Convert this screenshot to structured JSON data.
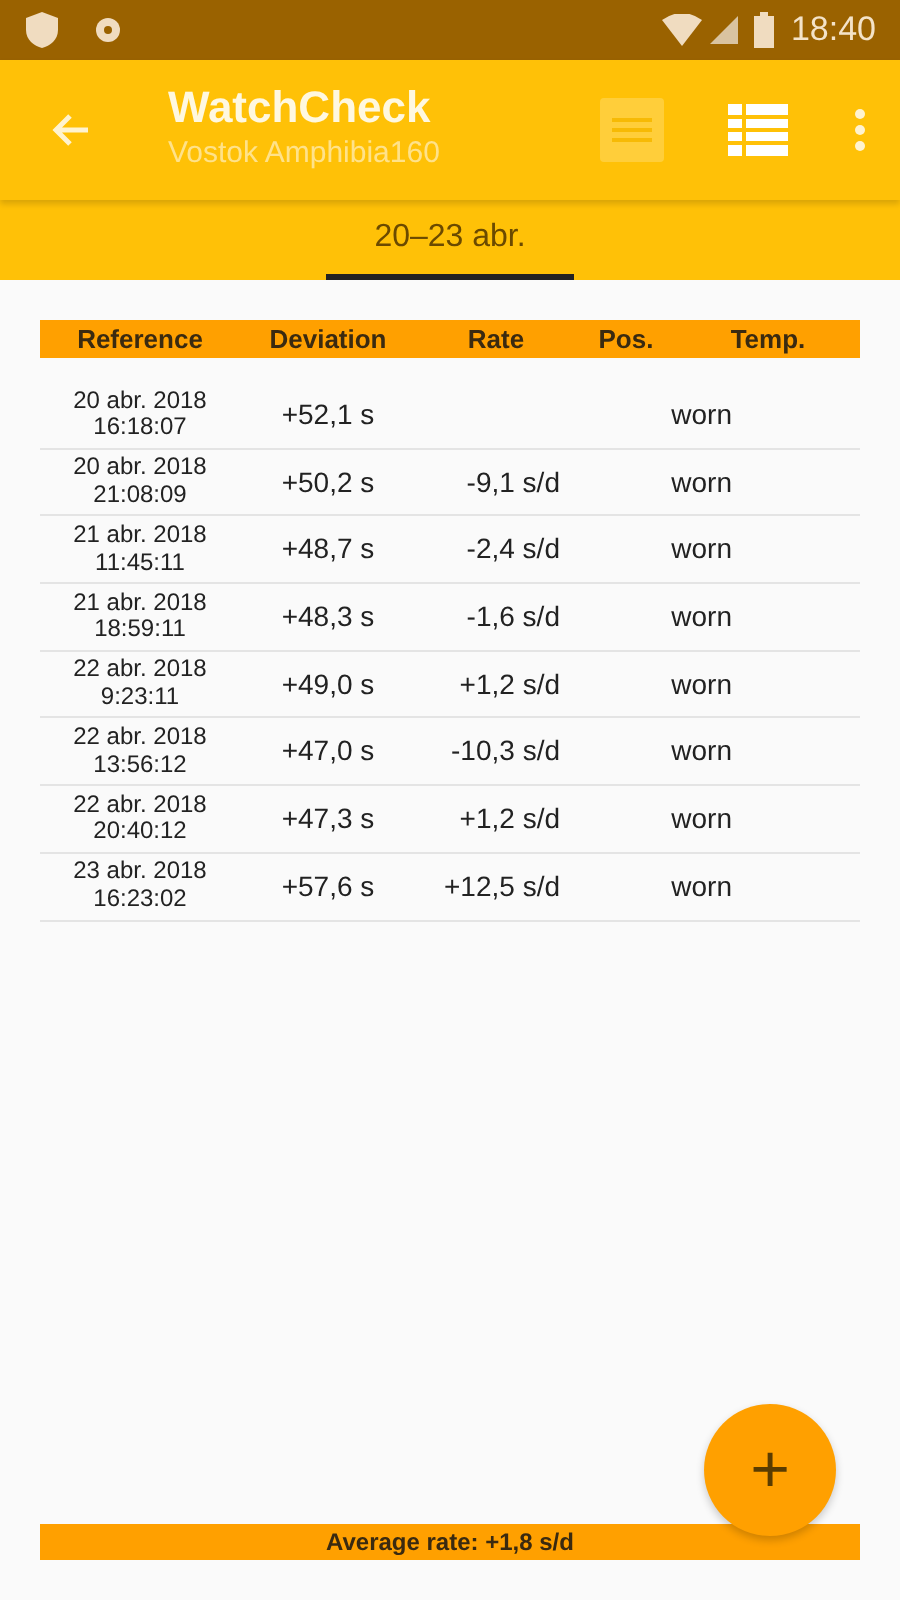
{
  "status_bar": {
    "time": "18:40"
  },
  "app_bar": {
    "title": "WatchCheck",
    "subtitle": "Vostok Amphibia160",
    "actions": [
      {
        "kind": "list",
        "disabled": true
      },
      {
        "kind": "table",
        "disabled": false
      },
      {
        "kind": "more",
        "disabled": false
      }
    ]
  },
  "tabs": [
    {
      "label": "20–23 abr.",
      "selected": true
    }
  ],
  "table": {
    "columns": [
      "Reference",
      "Deviation",
      "Rate",
      "Pos.",
      "Temp."
    ],
    "rows": [
      {
        "date": "20 abr. 2018",
        "time": "16:18:07",
        "deviation": "+52,1 s",
        "position": "worn"
      },
      {
        "date": "20 abr. 2018",
        "time": "21:08:09",
        "deviation": "+50,2 s",
        "rate": "-9,1 s/d",
        "position": "worn"
      },
      {
        "date": "21 abr. 2018",
        "time": "11:45:11",
        "deviation": "+48,7 s",
        "rate": "-2,4 s/d",
        "position": "worn"
      },
      {
        "date": "21 abr. 2018",
        "time": "18:59:11",
        "deviation": "+48,3 s",
        "rate": "-1,6 s/d",
        "position": "worn"
      },
      {
        "date": "22 abr. 2018",
        "time": "9:23:11",
        "deviation": "+49,0 s",
        "rate": "+1,2 s/d",
        "position": "worn"
      },
      {
        "date": "22 abr. 2018",
        "time": "13:56:12",
        "deviation": "+47,0 s",
        "rate": "-10,3 s/d",
        "position": "worn"
      },
      {
        "date": "22 abr. 2018",
        "time": "20:40:12",
        "deviation": "+47,3 s",
        "rate": "+1,2 s/d",
        "position": "worn"
      },
      {
        "date": "23 abr. 2018",
        "time": "16:23:02",
        "deviation": "+57,6 s",
        "rate": "+12,5 s/d",
        "position": "worn"
      }
    ]
  },
  "footer": {
    "text": "Average rate: +1,8 s/d"
  },
  "fab": {
    "label": "+"
  }
}
